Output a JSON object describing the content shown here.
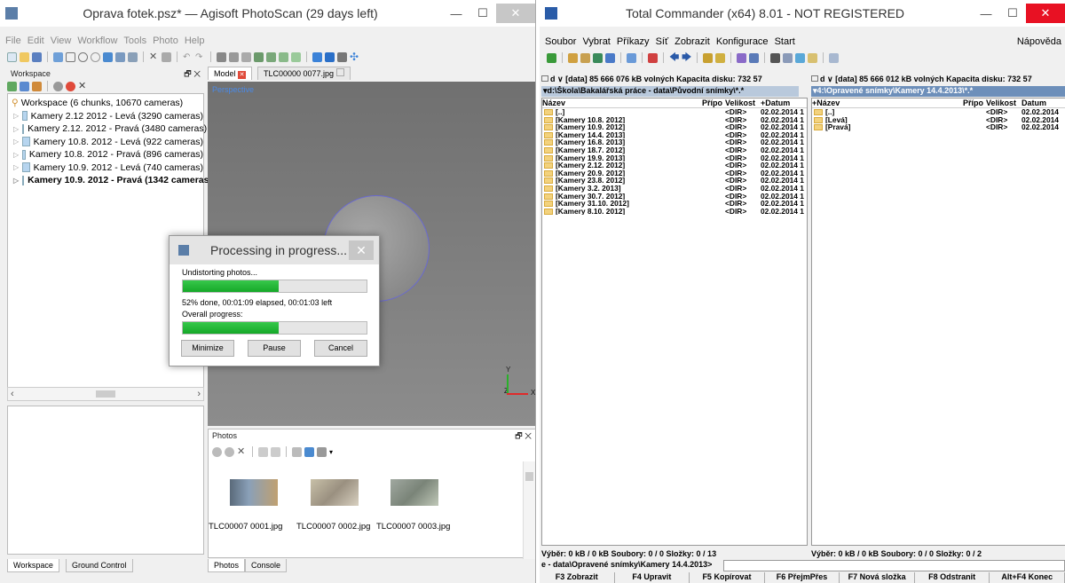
{
  "photoscan": {
    "title": "Oprava fotek.psz* — Agisoft PhotoScan (29 days left)",
    "menu": [
      "File",
      "Edit",
      "View",
      "Workflow",
      "Tools",
      "Photo",
      "Help"
    ],
    "workspace_panel": {
      "title": "Workspace",
      "root": "Workspace (6 chunks, 10670 cameras)",
      "chunks": [
        "Kamery 2.12 2012 - Levá (3290 cameras)",
        "Kamery 2.12. 2012 - Pravá (3480 cameras)",
        "Kamery 10.8. 2012 - Levá (922 cameras)",
        "Kamery 10.8. 2012 - Pravá (896 cameras)",
        "Kamery 10.9. 2012 - Levá (740 cameras)",
        "Kamery 10.9. 2012 - Pravá (1342 cameras)"
      ]
    },
    "tabs": {
      "model": "Model",
      "photo": "TLC00000 0077.jpg"
    },
    "viewport": {
      "perspective": "Perspective",
      "axis_y": "Y",
      "axis_z": "Z",
      "axis_x": "X"
    },
    "dialog": {
      "title": "Processing in progress...",
      "task": "Undistorting photos...",
      "task_progress": 0.52,
      "status": "52% done, 00:01:09 elapsed, 00:01:03 left",
      "overall_label": "Overall progress:",
      "overall_progress": 0.52,
      "minimize": "Minimize",
      "pause": "Pause",
      "cancel": "Cancel"
    },
    "photos_panel": {
      "title": "Photos",
      "items": [
        "TLC00007 0001.jpg",
        "TLC00007 0002.jpg",
        "TLC00007 0003.jpg"
      ]
    },
    "bottom_tabs": {
      "workspace": "Workspace",
      "ground": "Ground Control",
      "photos": "Photos",
      "console": "Console"
    }
  },
  "tc": {
    "title": "Total Commander (x64) 8.01 - NOT REGISTERED",
    "menu": [
      "Soubor",
      "Vybrat",
      "Příkazy",
      "Síť",
      "Zobrazit",
      "Konfigurace",
      "Start"
    ],
    "help": "Nápověda",
    "left": {
      "drive": "d  ∨  [data]  85 666 076 kB volných  Kapacita disku: 732 57",
      "path": "▾d:\\Škola\\Bakalářská práce - data\\Původní snímky\\*.*",
      "cols": {
        "name": "Název",
        "ext": "Přípo",
        "size": "Velikost",
        "date": "+Datum"
      },
      "rows": [
        {
          "n": "[..]",
          "s": "<DIR>",
          "d": "02.02.2014 1"
        },
        {
          "n": "[Kamery 10.8. 2012]",
          "s": "<DIR>",
          "d": "02.02.2014 1"
        },
        {
          "n": "[Kamery 10.9. 2012]",
          "s": "<DIR>",
          "d": "02.02.2014 1"
        },
        {
          "n": "[Kamery 14.4. 2013]",
          "s": "<DIR>",
          "d": "02.02.2014 1"
        },
        {
          "n": "[Kamery 16.8. 2013]",
          "s": "<DIR>",
          "d": "02.02.2014 1"
        },
        {
          "n": "[Kamery 18.7. 2012]",
          "s": "<DIR>",
          "d": "02.02.2014 1"
        },
        {
          "n": "[Kamery 19.9. 2013]",
          "s": "<DIR>",
          "d": "02.02.2014 1"
        },
        {
          "n": "[Kamery 2.12. 2012]",
          "s": "<DIR>",
          "d": "02.02.2014 1"
        },
        {
          "n": "[Kamery 20.9. 2012]",
          "s": "<DIR>",
          "d": "02.02.2014 1"
        },
        {
          "n": "[Kamery 23.8. 2012]",
          "s": "<DIR>",
          "d": "02.02.2014 1"
        },
        {
          "n": "[Kamery 3.2. 2013]",
          "s": "<DIR>",
          "d": "02.02.2014 1"
        },
        {
          "n": "[Kamery 30.7. 2012]",
          "s": "<DIR>",
          "d": "02.02.2014 1"
        },
        {
          "n": "[Kamery 31.10. 2012]",
          "s": "<DIR>",
          "d": "02.02.2014 1"
        },
        {
          "n": "[Kamery 8.10. 2012]",
          "s": "<DIR>",
          "d": "02.02.2014 1"
        }
      ],
      "status": "Výběr: 0 kB / 0 kB  Soubory: 0 / 0  Složky: 0 / 13"
    },
    "right": {
      "drive": "d  ∨  [data]  85 666 012 kB volných  Kapacita disku: 732 57",
      "path": "▾4:\\Opravené snímky\\Kamery 14.4.2013\\*.*",
      "cols": {
        "name": "+Název",
        "ext": "Přípo",
        "size": "Velikost",
        "date": "Datum"
      },
      "rows": [
        {
          "n": "[..]",
          "s": "<DIR>",
          "d": "02.02.2014"
        },
        {
          "n": "[Levá]",
          "s": "<DIR>",
          "d": "02.02.2014"
        },
        {
          "n": "[Pravá]",
          "s": "<DIR>",
          "d": "02.02.2014"
        }
      ],
      "status": "Výběr: 0 kB / 0 kB  Soubory: 0 / 0  Složky: 0 / 2"
    },
    "cmdpath": "e - data\\Opravené snímky\\Kamery 14.4.2013>",
    "fkeys": [
      "F3 Zobrazit",
      "F4 Upravit",
      "F5 Kopírovat",
      "F6 PřejmPřes",
      "F7 Nová složka",
      "F8 Odstranit",
      "Alt+F4 Konec"
    ]
  }
}
